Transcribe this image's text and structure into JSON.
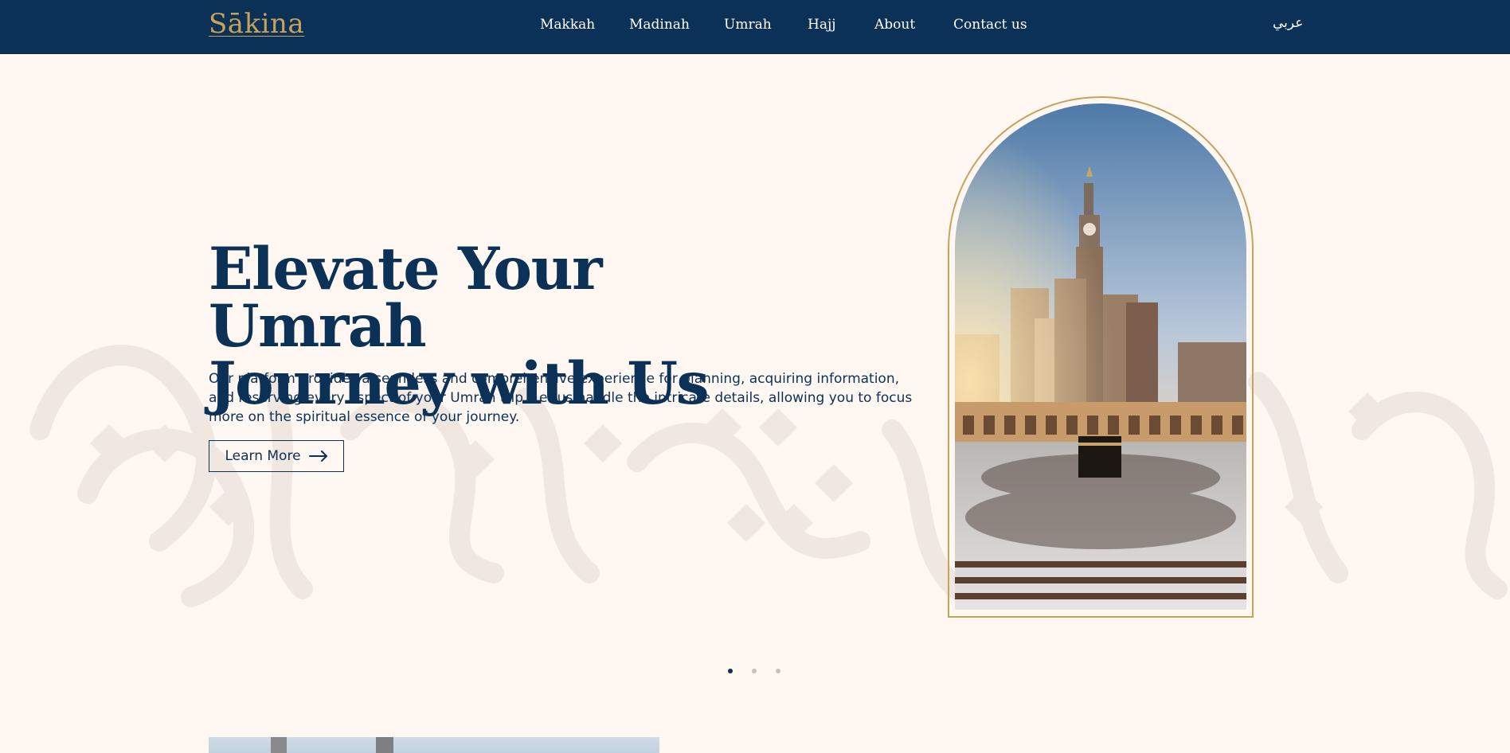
{
  "brand": {
    "logo_text": "Sākina",
    "logo_color": "#c8a15a"
  },
  "nav": {
    "items": [
      {
        "label": "Makkah"
      },
      {
        "label": "Madinah"
      },
      {
        "label": "Umrah"
      },
      {
        "label": "Hajj"
      },
      {
        "label": "About"
      },
      {
        "label": "Contact us"
      }
    ],
    "language_toggle": "عربي",
    "background": "#0b3156"
  },
  "hero": {
    "title_line1": "Elevate Your Umrah",
    "title_line2": "Journey with Us",
    "description": "Our platform provides a seamless and comprehensive experience for planning, acquiring information, and reserving every aspect of your Umrah trip. Let us handle the intricate details, allowing you to focus more on the spiritual essence of your journey.",
    "cta_label": "Learn More",
    "image_subject": "Masjid al-Haram with the Kaaba and the Makkah Clock Royal Tower",
    "accent": "#c8a15a",
    "text_color": "#0b3156"
  },
  "carousel": {
    "slide_count": 3,
    "active_index": 0
  },
  "icons": {
    "cta": "arrow-right-icon"
  }
}
